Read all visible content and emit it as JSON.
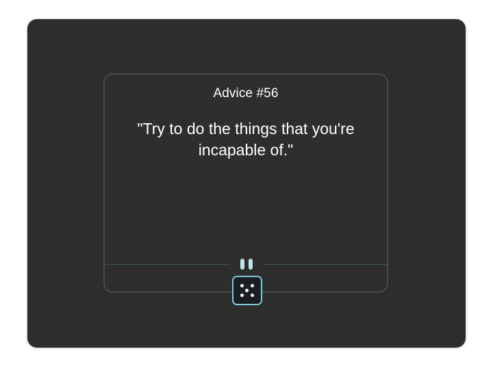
{
  "advice": {
    "title": "Advice #56",
    "quote": "\"Try to do the things that you're incapable of.\""
  },
  "controls": {
    "pause_icon": "pause-icon",
    "dice_icon": "dice-five-icon"
  },
  "colors": {
    "panel_background": "#2d2d2d",
    "card_border": "#4a4a4a",
    "accent": "#7ec8dc",
    "pause_bars": "#bfe4ee",
    "divider": "#3d5560",
    "dice_background": "#1b1f23"
  }
}
